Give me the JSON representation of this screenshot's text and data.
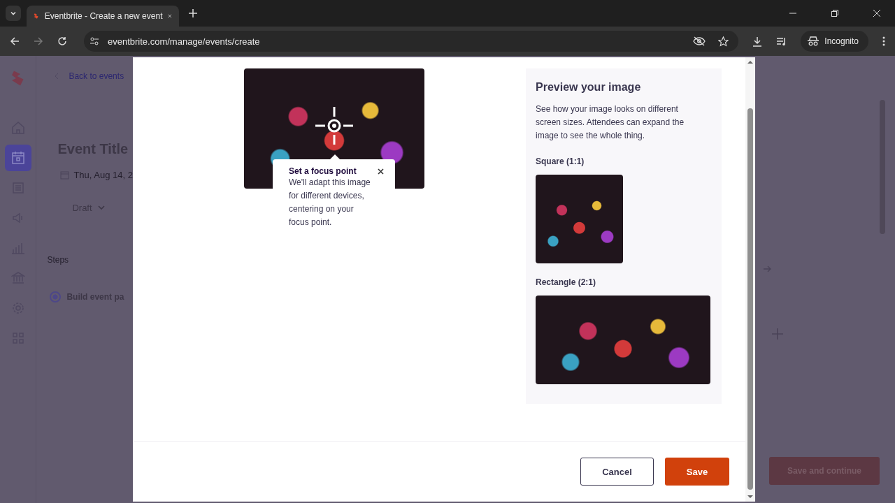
{
  "browser": {
    "tabs": [
      {
        "title": "Eventbrite - Create a new event",
        "selected": true
      }
    ],
    "url": "eventbrite.com/manage/events/create",
    "profile": "Incognito"
  },
  "sidebar": {
    "items": [
      {
        "kind": "home",
        "selected": false
      },
      {
        "kind": "calendar",
        "selected": true
      },
      {
        "kind": "list",
        "selected": false
      },
      {
        "kind": "megaphone",
        "selected": false
      },
      {
        "kind": "chart",
        "selected": false
      },
      {
        "kind": "bank",
        "selected": false
      },
      {
        "kind": "gear",
        "selected": false
      },
      {
        "kind": "apps",
        "selected": false
      }
    ]
  },
  "background_page": {
    "back_link": "Back to events",
    "event_title": "Event Title",
    "date": "Thu, Aug 14, 2",
    "status": "Draft",
    "steps_heading": "Steps",
    "steps": [
      {
        "label": "Build event pa",
        "selected": true
      }
    ],
    "save_continue_button": "Save and continue"
  },
  "modal": {
    "focus_tooltip": {
      "title": "Set a focus point",
      "body": "We'll adapt this image for different devices, centering on your focus point."
    },
    "preview": {
      "title": "Preview your image",
      "description": "See how your image looks on different screen sizes. Attendees can expand the image to see the whole thing.",
      "square_label": "Square (1:1)",
      "rectangle_label": "Rectangle (2:1)"
    },
    "buttons": {
      "cancel": "Cancel",
      "save": "Save"
    }
  }
}
